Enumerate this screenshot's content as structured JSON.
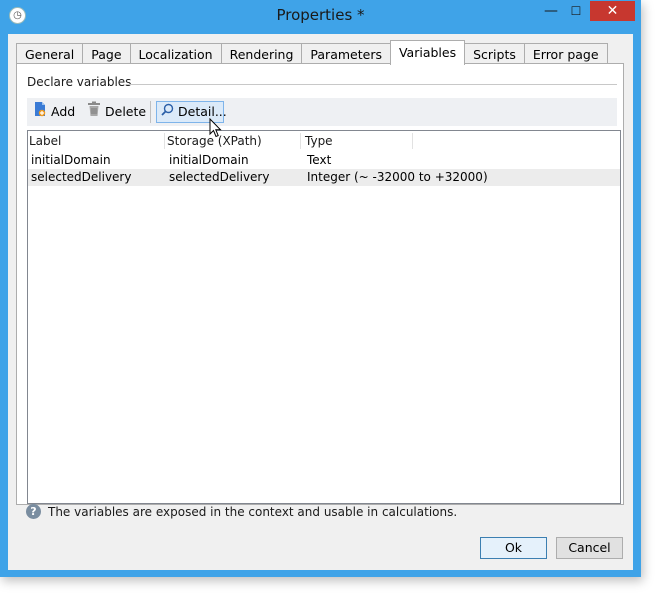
{
  "window": {
    "title": "Properties *",
    "minimize": "—",
    "maximize": "☐",
    "close": "✕"
  },
  "tabs": [
    {
      "label": "General"
    },
    {
      "label": "Page"
    },
    {
      "label": "Localization"
    },
    {
      "label": "Rendering"
    },
    {
      "label": "Parameters"
    },
    {
      "label": "Variables",
      "active": true
    },
    {
      "label": "Scripts"
    },
    {
      "label": "Error page"
    }
  ],
  "section": {
    "label": "Declare variables"
  },
  "toolbar": {
    "add_label": "Add",
    "delete_label": "Delete",
    "detail_label": "Detail..."
  },
  "grid": {
    "columns": [
      "Label",
      "Storage (XPath)",
      "Type"
    ],
    "rows": [
      [
        "initialDomain",
        "initialDomain",
        "Text"
      ],
      [
        "selectedDelivery",
        "selectedDelivery",
        "Integer (~ -32000 to +32000)"
      ]
    ]
  },
  "help_text": "The variables are exposed in the context and usable in calculations.",
  "buttons": {
    "ok": "Ok",
    "cancel": "Cancel"
  },
  "colors": {
    "window_frame": "#3fa3e8",
    "close_button": "#c7372f",
    "detail_highlight": "#dbeaf9"
  }
}
